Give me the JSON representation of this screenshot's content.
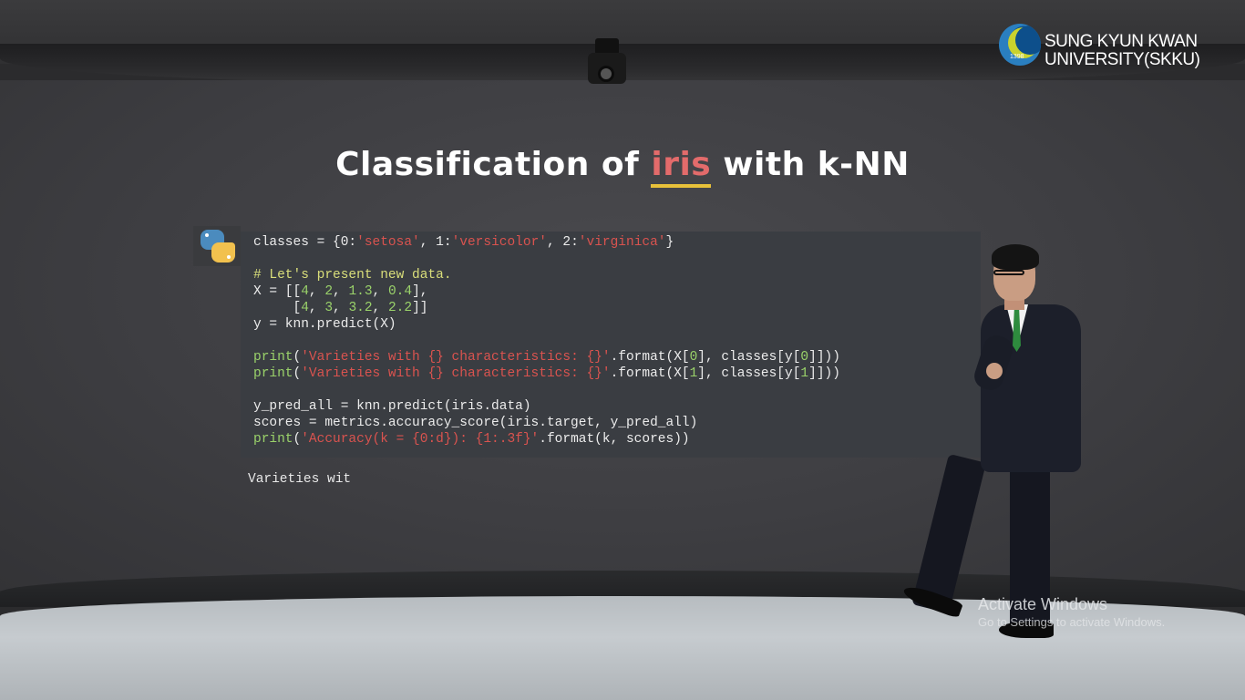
{
  "logo": {
    "line1": "SUNG KYUN KWAN",
    "line2": "UNIVERSITY(SKKU)",
    "year": "1398"
  },
  "slide": {
    "title_before": "Classification of ",
    "title_highlight": "iris",
    "title_after": " with k-NN"
  },
  "code": [
    [
      {
        "t": "classes = {0:",
        "c": ""
      },
      {
        "t": "'setosa'",
        "c": "str"
      },
      {
        "t": ", 1:",
        "c": ""
      },
      {
        "t": "'versicolor'",
        "c": "str"
      },
      {
        "t": ", 2:",
        "c": ""
      },
      {
        "t": "'virginica'",
        "c": "str"
      },
      {
        "t": "}",
        "c": ""
      }
    ],
    [],
    [
      {
        "t": "# Let's present new data.",
        "c": "cmt"
      }
    ],
    [
      {
        "t": "X = [[",
        "c": ""
      },
      {
        "t": "4",
        "c": "num"
      },
      {
        "t": ", ",
        "c": ""
      },
      {
        "t": "2",
        "c": "num"
      },
      {
        "t": ", ",
        "c": ""
      },
      {
        "t": "1.3",
        "c": "num"
      },
      {
        "t": ", ",
        "c": ""
      },
      {
        "t": "0.4",
        "c": "num"
      },
      {
        "t": "],",
        "c": ""
      }
    ],
    [
      {
        "t": "     [",
        "c": ""
      },
      {
        "t": "4",
        "c": "num"
      },
      {
        "t": ", ",
        "c": ""
      },
      {
        "t": "3",
        "c": "num"
      },
      {
        "t": ", ",
        "c": ""
      },
      {
        "t": "3.2",
        "c": "num"
      },
      {
        "t": ", ",
        "c": ""
      },
      {
        "t": "2.2",
        "c": "num"
      },
      {
        "t": "]]",
        "c": ""
      }
    ],
    [
      {
        "t": "y = knn.predict(X)",
        "c": ""
      }
    ],
    [],
    [
      {
        "t": "print",
        "c": "kw"
      },
      {
        "t": "(",
        "c": ""
      },
      {
        "t": "'Varieties with {} characteristics: {}'",
        "c": "str"
      },
      {
        "t": ".format(X[",
        "c": ""
      },
      {
        "t": "0",
        "c": "num"
      },
      {
        "t": "], classes[y[",
        "c": ""
      },
      {
        "t": "0",
        "c": "num"
      },
      {
        "t": "]]))",
        "c": ""
      }
    ],
    [
      {
        "t": "print",
        "c": "kw"
      },
      {
        "t": "(",
        "c": ""
      },
      {
        "t": "'Varieties with {} characteristics: {}'",
        "c": "str"
      },
      {
        "t": ".format(X[",
        "c": ""
      },
      {
        "t": "1",
        "c": "num"
      },
      {
        "t": "], classes[y[",
        "c": ""
      },
      {
        "t": "1",
        "c": "num"
      },
      {
        "t": "]]))",
        "c": ""
      }
    ],
    [],
    [
      {
        "t": "y_pred_all = knn.predict(iris.data)",
        "c": ""
      }
    ],
    [
      {
        "t": "scores = metrics.accuracy_score(iris.target, y_pred_all)",
        "c": ""
      }
    ],
    [
      {
        "t": "print",
        "c": "kw"
      },
      {
        "t": "(",
        "c": ""
      },
      {
        "t": "'Accuracy(k = {0:d}): {1:.3f}'",
        "c": "str"
      },
      {
        "t": ".format(k, scores))",
        "c": ""
      }
    ]
  ],
  "output": {
    "text": "Varieties wit"
  },
  "watermark": {
    "title": "Activate Windows",
    "subtitle": "Go to Settings to activate Windows."
  },
  "icons": {
    "logo": "skku-emblem-icon",
    "python": "python-icon",
    "camera": "ceiling-camera-icon"
  },
  "colors": {
    "highlight": "#e36b6b",
    "underline": "#e8c13a",
    "string": "#d9534f",
    "number": "#9ad26a",
    "comment": "#d9de7a"
  }
}
